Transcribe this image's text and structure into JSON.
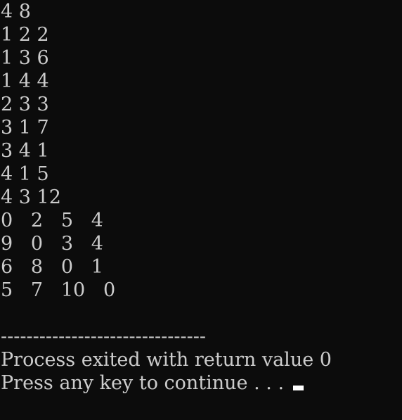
{
  "console": {
    "input_lines": [
      "4 8",
      "1 2 2",
      "1 3 6",
      "1 4 4",
      "2 3 3",
      "3 1 7",
      "3 4 1",
      "4 1 5",
      "4 3 12"
    ],
    "matrix_rows": [
      "0   2   5   4",
      "9   0   3   4",
      "6   8   0   1",
      "5   7   10   0"
    ],
    "blank": "",
    "separator": "--------------------------------",
    "process_exit": "Process exited with return value 0",
    "press_key": "Press any key to continue . . . "
  }
}
